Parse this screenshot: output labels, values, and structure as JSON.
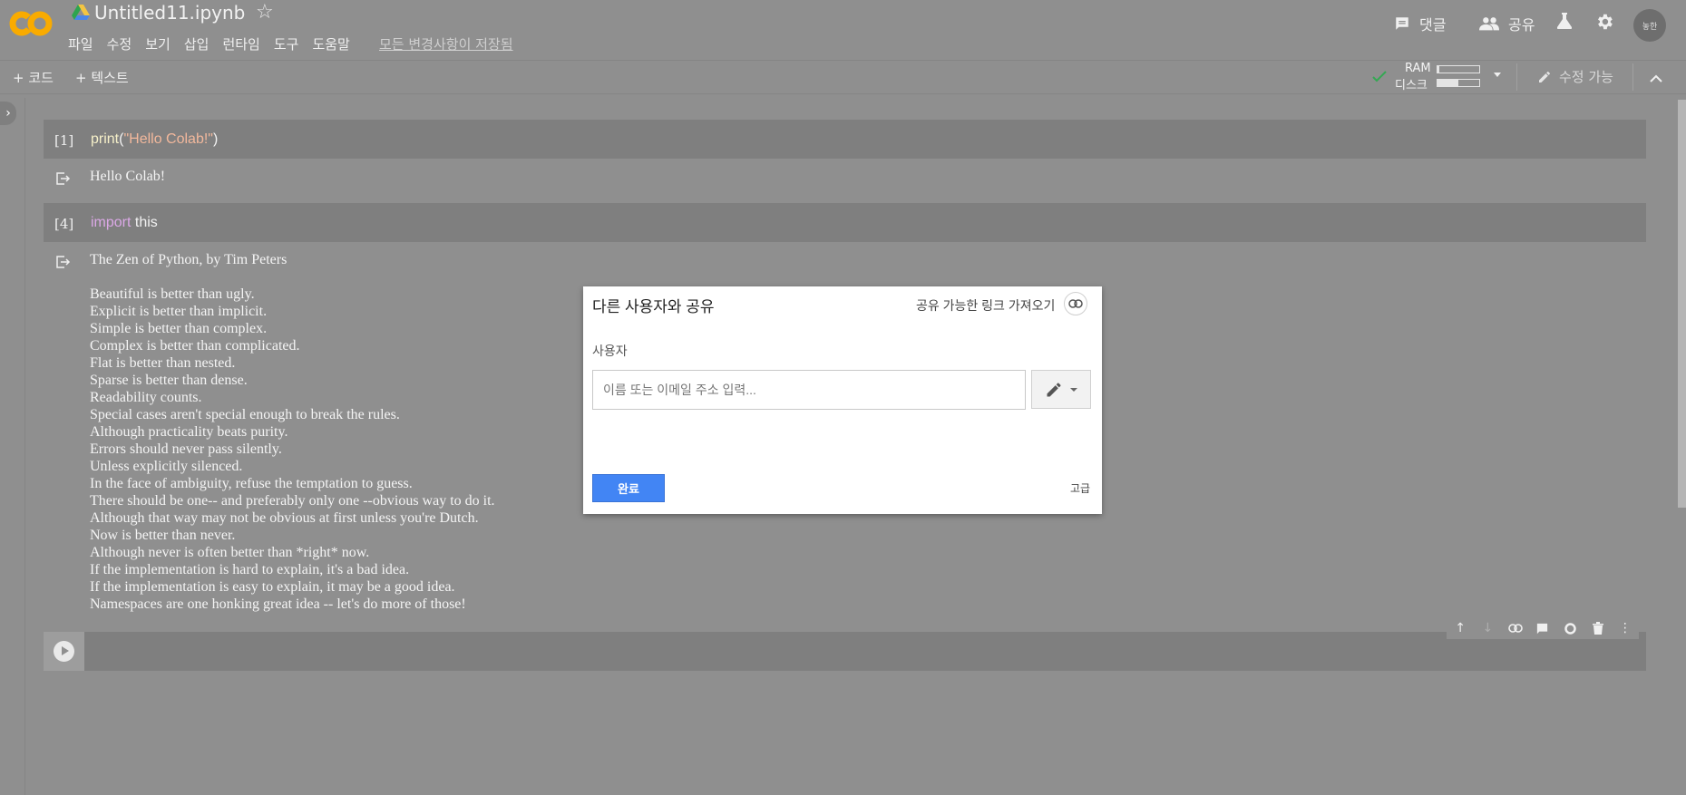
{
  "header": {
    "notebook_title": "Untitled11.ipynb",
    "menu": [
      "파일",
      "수정",
      "보기",
      "삽입",
      "런타임",
      "도구",
      "도움말"
    ],
    "saved_status": "모든 변경사항이 저장됨",
    "comments_label": "댓글",
    "share_label": "공유",
    "avatar_text": "놓한",
    "logo_text": "CO"
  },
  "toolbar": {
    "add_code": "+ 코드",
    "add_text": "+ 텍스트",
    "ram_label": "RAM",
    "disk_label": "디스크",
    "ram_usage": 0.05,
    "disk_usage": 0.5,
    "editable_label": "수정 가능",
    "status_color": "#34a853"
  },
  "cells": [
    {
      "count": "[1]",
      "code_fn": "print",
      "code_open": "(",
      "code_str": "\"Hello Colab!\"",
      "code_close": ")",
      "output": "Hello Colab!"
    },
    {
      "count": "[4]",
      "code_kw": "import",
      "code_rest": " this",
      "output_title": "The Zen of Python, by Tim Peters",
      "output_lines": [
        "Beautiful is better than ugly.",
        "Explicit is better than implicit.",
        "Simple is better than complex.",
        "Complex is better than complicated.",
        "Flat is better than nested.",
        "Sparse is better than dense.",
        "Readability counts.",
        "Special cases aren't special enough to break the rules.",
        "Although practicality beats purity.",
        "Errors should never pass silently.",
        "Unless explicitly silenced.",
        "In the face of ambiguity, refuse the temptation to guess.",
        "There should be one-- and preferably only one --obvious way to do it.",
        "Although that way may not be obvious at first unless you're Dutch.",
        "Now is better than never.",
        "Although never is often better than *right* now.",
        "If the implementation is hard to explain, it's a bad idea.",
        "If the implementation is easy to explain, it may be a good idea.",
        "Namespaces are one honking great idea -- let's do more of those!"
      ]
    }
  ],
  "dialog": {
    "title": "다른 사용자와 공유",
    "get_link": "공유 가능한 링크 가져오기",
    "users_label": "사용자",
    "input_placeholder": "이름 또는 이메일 주소 입력...",
    "done_button": "완료",
    "advanced": "고급",
    "accent_color": "#4285f4"
  }
}
